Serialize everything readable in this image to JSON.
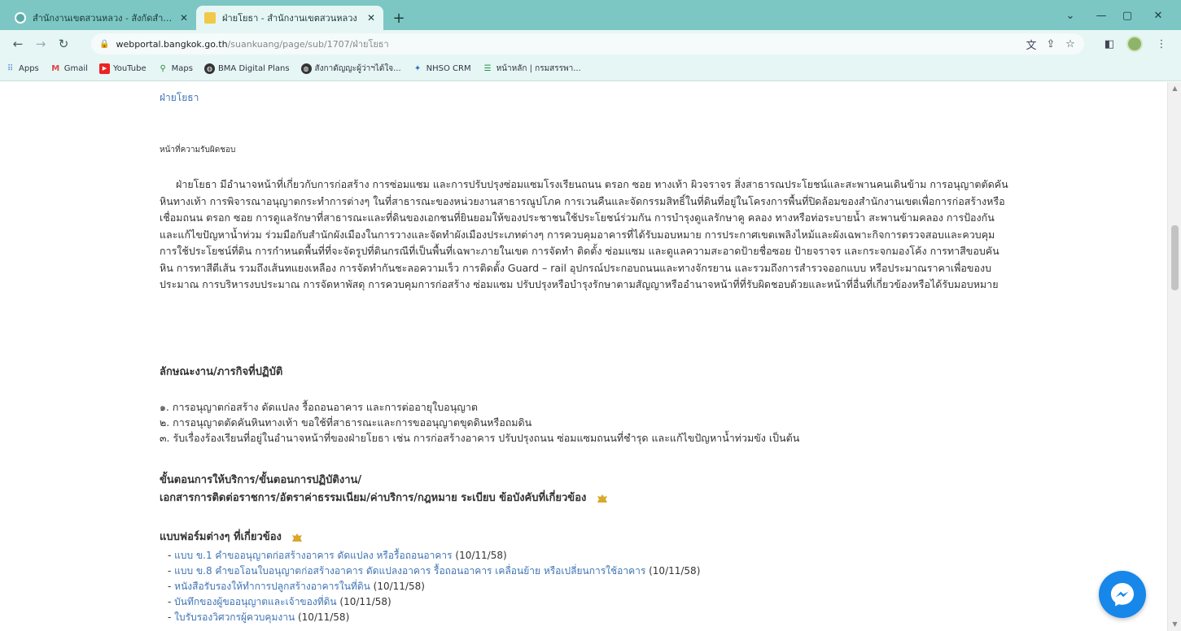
{
  "browser": {
    "tabs": [
      {
        "title": "สำนักงานเขตสวนหลวง - สังกัดสำนัก…",
        "active": false
      },
      {
        "title": "ฝ่ายโยธา - สำนักงานเขตสวนหลวง",
        "active": true
      }
    ],
    "url_host": "webportal.bangkok.go.th",
    "url_path": "/suankuang/page/sub/1707/ฝ่ายโยธา",
    "bookmarks": [
      {
        "label": "Apps",
        "icon": "apps-grid-icon"
      },
      {
        "label": "Gmail",
        "icon": "gmail-icon"
      },
      {
        "label": "YouTube",
        "icon": "youtube-icon"
      },
      {
        "label": "Maps",
        "icon": "maps-icon"
      },
      {
        "label": "BMA Digital Plans",
        "icon": "globe-icon"
      },
      {
        "label": "สังกาดัญญะผู้ว่าฯได้ใจ...",
        "icon": "globe-icon"
      },
      {
        "label": "NHSO CRM",
        "icon": "nhso-icon"
      },
      {
        "label": "หน้าหลัก | กรมสรรพา...",
        "icon": "sheet-icon"
      }
    ]
  },
  "page": {
    "breadcrumb": "ฝ่ายโยธา",
    "duty_heading": "หน้าที่ความรับผิดชอบ",
    "intro_text": "ฝ่ายโยธา มีอำนาจหน้าที่เกี่ยวกับการก่อสร้าง การซ่อมแซม และการปรับปรุงซ่อมแซมโรงเรียนถนน ตรอก ซอย ทางเท้า ผิวจราจร สิ่งสาธารณประโยชน์และสะพานคนเดินข้าม การอนุญาตตัดคันหินทางเท้า การพิจารณาอนุญาตกระทำการต่างๆ ในที่สาธารณะของหน่วยงานสาธารณูปโภค การเวนคืนและจัดกรรมสิทธิ์ในที่ดินที่อยู่ในโครงการพื้นที่ปิดล้อมของสำนักงานเขตเพื่อการก่อสร้างหรือเชื่อมถนน ตรอก ซอย การดูแลรักษาที่สาธารณะและที่ดินของเอกชนที่ยินยอมให้ของประชาชนใช้ประโยชน์ร่วมกัน การบำรุงดูแลรักษาคู คลอง ทางหรือท่อระบายน้ำ สะพานข้ามคลอง การป้องกันและแก้ไขปัญหาน้ำท่วม ร่วมมือกับสำนักผังเมืองในการวางและจัดทำผังเมืองประเภทต่างๆ การควบคุมอาคารที่ได้รับมอบหมาย การประกาศเขตเพลิงไหม้และผังเฉพาะกิจการตรวจสอบและควบคุมการใช้ประโยชน์ที่ดิน การกำหนดพื้นที่ที่จะจัดรูปที่ดินกรณีที่เป็นพื้นที่เฉพาะภายในเขต การจัดทำ ติดตั้ง ซ่อมแซม และดูแลความสะอาดป้ายชื่อซอย ป้ายจราจร และกระจกมองโค้ง การทาสีขอบคันหิน การทาสีตีเส้น รวมถึงเส้นทแยงเหลือง การจัดทำกันชะลอความเร็ว การติดตั้ง Guard – rail อุปกรณ์ประกอบถนนและทางจักรยาน และรวมถึงการสำรวจออกแบบ หรือประมาณราคาเพื่อของบประมาณ การบริหารงบประมาณ การจัดหาพัสดุ การควบคุมการก่อสร้าง ซ่อมแซม ปรับปรุงหรือบำรุงรักษาตามสัญญาหรืออำนาจหน้าที่ที่รับผิดชอบด้วยและหน้าที่อื่นที่เกี่ยวข้องหรือได้รับมอบหมาย",
    "mission_heading": "ลักษณะงาน/ภารกิจที่ปฏิบัติ",
    "missions": [
      "๑. การอนุญาตก่อสร้าง ดัดแปลง รื้อถอนอาคาร และการต่ออายุใบอนุญาต",
      "๒. การอนุญาตตัดคันหินทางเท้า ขอใช้ที่สาธารณะและการขออนุญาตขุดดินหรือถมดิน",
      "๓. รับเรื่องร้องเรียนที่อยู่ในอำนาจหน้าที่ของฝ่ายโยธา เช่น การก่อสร้างอาคาร ปรับปรุงถนน ซ่อมแซมถนนที่ชำรุด และแก้ไขปัญหาน้ำท่วมขัง เป็นต้น"
    ],
    "procedure_heading_1": "ขั้นตอนการให้บริการ/ขั้นตอนการปฏิบัติงาน/",
    "procedure_heading_2": "เอกสารการติดต่อราชการ/อัตราค่าธรรมเนียม/ค่าบริการ/กฎหมาย ระเบียบ ข้อบังคับที่เกี่ยวข้อง",
    "forms_heading": "แบบฟอร์มต่างๆ ที่เกี่ยวข้อง",
    "forms": [
      {
        "prefix": "- ",
        "link": "แบบ ข.1 คำขออนุญาตก่อสร้างอาคาร ดัดแปลง หรือรื้อถอนอาคาร",
        "date": " (10/11/58)"
      },
      {
        "prefix": "- ",
        "link": "แบบ ข.8 คำขอโอนใบอนุญาตก่อสร้างอาคาร ดัดแปลงอาคาร รื้อถอนอาคาร เคลื่อนย้าย หรือเปลี่ยนการใช้อาคาร",
        "date": " (10/11/58)"
      },
      {
        "prefix": "- ",
        "link": "หนังสือรับรองให้ทำการปลูกสร้างอาคารในที่ดิน",
        "date": " (10/11/58)"
      },
      {
        "prefix": "- ",
        "link": "บันทึกของผู้ขออนุญาตและเจ้าของที่ดิน",
        "date": " (10/11/58)"
      },
      {
        "prefix": "- ",
        "link": "ใบรับรองวิศวกรผู้ควบคุมงาน",
        "date": " (10/11/58)"
      }
    ]
  },
  "colors": {
    "tabstrip": "#7cc7c4",
    "toolbar": "#e6f6f5",
    "link": "#3f74b5",
    "messenger": "#1787ea"
  }
}
